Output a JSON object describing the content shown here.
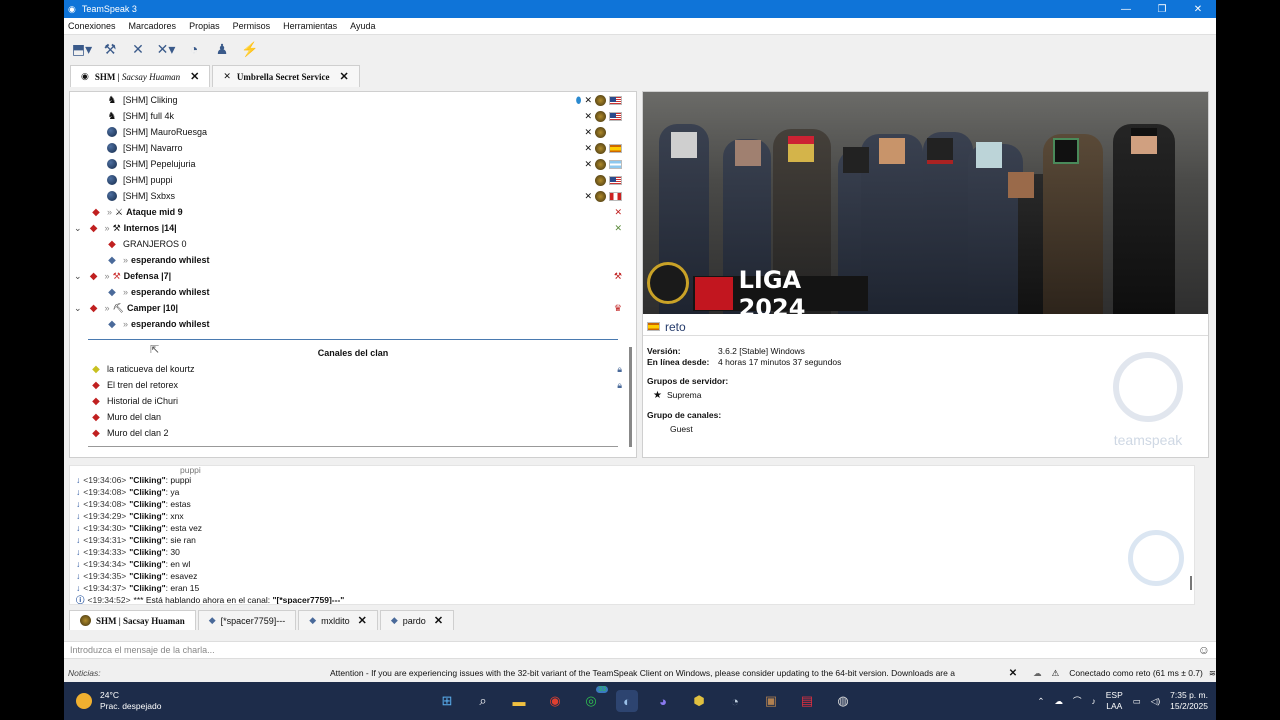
{
  "window": {
    "title": "TeamSpeak 3",
    "controls": [
      "—",
      "❐",
      "✕"
    ]
  },
  "menu": [
    "Conexiones",
    "Marcadores",
    "Propias",
    "Permisos",
    "Herramientas",
    "Ayuda"
  ],
  "server_tabs": [
    {
      "prefix": "SHM |",
      "name": "Sacsay Huaman",
      "close": "✕"
    },
    {
      "prefix": "",
      "name": "Umbrella Secret Service",
      "close": "✕"
    }
  ],
  "tree": {
    "users": [
      {
        "name": "[SHM] Cliking",
        "flag": "us"
      },
      {
        "name": "[SHM] full 4k",
        "flag": "us"
      },
      {
        "name": "[SHM] MauroRuesga",
        "flag": ""
      },
      {
        "name": "[SHM] Navarro",
        "flag": "es"
      },
      {
        "name": "[SHM] Pepelujuria",
        "flag": "ar"
      },
      {
        "name": "[SHM] puppi",
        "flag": "us"
      },
      {
        "name": "[SHM] Sxbxs",
        "flag": "pe"
      }
    ],
    "ataque": "Ataque mid 9",
    "internos": "Internos |14|",
    "granjeros": "GRANJEROS 0",
    "esperando": "esperando whilest",
    "defensa": "Defensa |7|",
    "camper": "Camper |10|",
    "clan_header": "Canales del clan",
    "clan_channels": [
      "la raticueva del kourtz",
      "El tren del retorex",
      "Historial de iChuri",
      "Muro del clan",
      "Muro del clan 2"
    ]
  },
  "info": {
    "banner_text": "LIGA 2024",
    "name": "reto",
    "version_label": "Versión:",
    "version_value": "3.6.2 [Stable] Windows",
    "online_label": "En línea desde:",
    "online_value": "4 horas 17 minutos 37 segundos",
    "server_groups_label": "Grupos de servidor:",
    "server_group": "Suprema",
    "channel_group_label": "Grupo de canales:",
    "channel_group": "Guest",
    "logo_text": "teamspeak"
  },
  "chat": {
    "partial": "puppi",
    "lines": [
      {
        "ts": "<19:34:06>",
        "nick": "\"Cliking\"",
        "msg": ": puppi"
      },
      {
        "ts": "<19:34:08>",
        "nick": "\"Cliking\"",
        "msg": ": ya"
      },
      {
        "ts": "<19:34:08>",
        "nick": "\"Cliking\"",
        "msg": ": estas"
      },
      {
        "ts": "<19:34:29>",
        "nick": "\"Cliking\"",
        "msg": ": xnx"
      },
      {
        "ts": "<19:34:30>",
        "nick": "\"Cliking\"",
        "msg": ": esta vez"
      },
      {
        "ts": "<19:34:31>",
        "nick": "\"Cliking\"",
        "msg": ": sie ran"
      },
      {
        "ts": "<19:34:33>",
        "nick": "\"Cliking\"",
        "msg": ": 30"
      },
      {
        "ts": "<19:34:34>",
        "nick": "\"Cliking\"",
        "msg": ": en wl"
      },
      {
        "ts": "<19:34:35>",
        "nick": "\"Cliking\"",
        "msg": ": esavez"
      },
      {
        "ts": "<19:34:37>",
        "nick": "\"Cliking\"",
        "msg": ": eran 15"
      }
    ],
    "last": {
      "ts": "<19:34:52>",
      "text": "*** Está hablando ahora en el canal: ",
      "channel": "\"[*spacer7759]---\""
    }
  },
  "chat_tabs": [
    {
      "label": "SHM | Sacsay Huaman",
      "close": ""
    },
    {
      "label": "[*spacer7759]---",
      "close": ""
    },
    {
      "label": "mxldito",
      "close": "✕"
    },
    {
      "label": "pardo",
      "close": "✕"
    }
  ],
  "input_placeholder": "Introduzca el mensaje de la charla...",
  "status": {
    "news": "Noticias:",
    "attention": "Attention - If you are experiencing issues with the 32-bit variant of the TeamSpeak Client on Windows, please consider updating to the 64-bit version. Downloads are a",
    "connected": "Conectado como reto (61 ms ± 0.7)"
  },
  "taskbar": {
    "temp": "24°C",
    "weather": "Prac. despejado",
    "lang1": "ESP",
    "lang2": "LAA",
    "time": "7:35 p. m.",
    "date": "15/2/2025",
    "badge": "33"
  },
  "colors": {
    "titlebar": "#0f74d8",
    "taskbar": "#1d2c4a",
    "channel_red": "#c02020"
  }
}
